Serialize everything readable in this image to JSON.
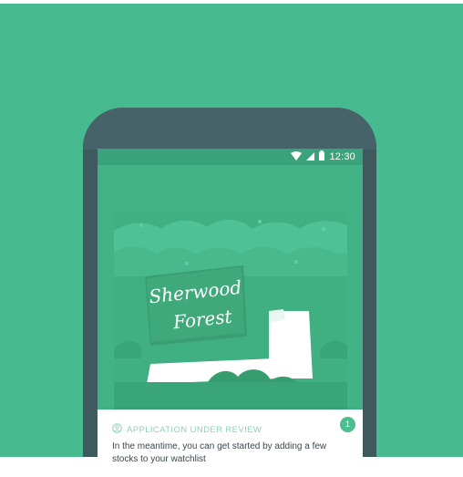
{
  "status_bar": {
    "time": "12:30",
    "icons": [
      "wifi-icon",
      "cellular-signal-icon",
      "battery-icon"
    ]
  },
  "illustration": {
    "sign_line1": "Sherwood",
    "sign_line2": "Forest"
  },
  "card": {
    "header": "APPLICATION UNDER REVIEW",
    "header_icon": "user-clock-icon",
    "badge": "1",
    "text": "In the meantime, you can get started by adding a few stocks to your watchlist"
  },
  "colors": {
    "background": "#47bb8f",
    "phone_body": "#3f5a5e",
    "screen": "#43b387",
    "accent": "#4cbd8f"
  }
}
